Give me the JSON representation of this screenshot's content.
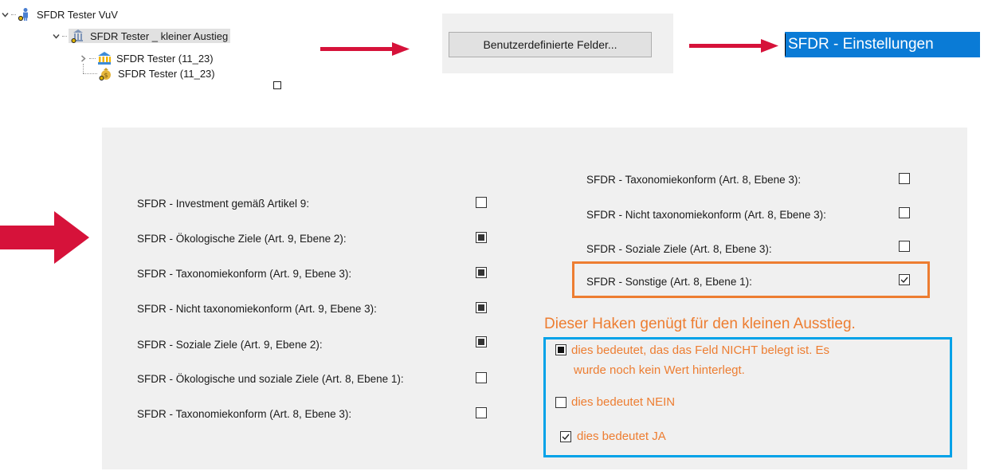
{
  "tree": {
    "items": [
      {
        "label": "SFDR Tester VuV",
        "icon": "person-icon",
        "expanded": true
      },
      {
        "label": "SFDR Tester _ kleiner Austieg",
        "icon": "bank-building-icon",
        "expanded": true,
        "selected": true
      },
      {
        "label": "SFDR Tester (11_23)",
        "icon": "bank-icon",
        "expanded": false
      },
      {
        "label": "SFDR Tester (11_23)",
        "icon": "money-bag-icon"
      }
    ]
  },
  "toolbar": {
    "custom_fields_button": "Benutzerdefinierte Felder..."
  },
  "menu": {
    "selected_item": "SFDR - Einstellungen"
  },
  "fields_left": [
    {
      "label": "SFDR - Investment gemäß Artikel 9:",
      "state": "unchecked"
    },
    {
      "label": "SFDR - Ökologische Ziele (Art. 9, Ebene 2):",
      "state": "indeterminate"
    },
    {
      "label": "SFDR - Taxonomiekonform (Art. 9, Ebene 3):",
      "state": "indeterminate"
    },
    {
      "label": "SFDR - Nicht taxonomiekonform (Art. 9, Ebene 3):",
      "state": "indeterminate"
    },
    {
      "label": "SFDR - Soziale Ziele (Art. 9, Ebene 2):",
      "state": "indeterminate"
    },
    {
      "label": "SFDR - Ökologische und soziale Ziele (Art. 8, Ebene 1):",
      "state": "unchecked"
    },
    {
      "label": "SFDR - Taxonomiekonform (Art. 8, Ebene 3):",
      "state": "unchecked"
    }
  ],
  "fields_right": [
    {
      "label": "SFDR - Taxonomiekonform (Art. 8, Ebene 3):",
      "state": "unchecked"
    },
    {
      "label": "SFDR - Nicht taxonomiekonform (Art. 8, Ebene 3):",
      "state": "unchecked"
    },
    {
      "label": "SFDR - Soziale Ziele (Art. 8, Ebene 3):",
      "state": "unchecked"
    },
    {
      "label": "SFDR - Sonstige (Art. 8, Ebene 1):",
      "state": "checked"
    }
  ],
  "annotation": {
    "headline": "Dieser Haken genügt für den kleinen Ausstieg.",
    "legend": [
      {
        "state": "indeterminate",
        "line1": "dies bedeutet, das das Feld NICHT belegt ist. Es",
        "line2": "wurde noch kein Wert hinterlegt."
      },
      {
        "state": "unchecked",
        "line1": "dies bedeutet NEIN"
      },
      {
        "state": "checked",
        "line1": "dies bedeutet JA"
      }
    ]
  },
  "colors": {
    "arrow": "#d6123a",
    "highlight_orange": "#ed7d31",
    "highlight_blue": "#00a2e8",
    "selection_blue": "#0a7bd6"
  }
}
